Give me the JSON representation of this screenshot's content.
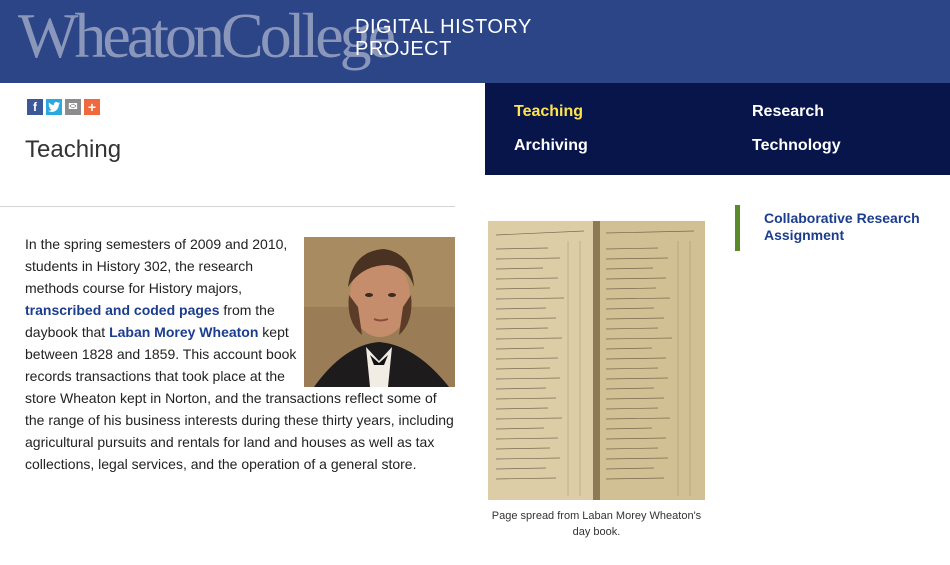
{
  "header": {
    "logo_text": "WheatonCollege",
    "site_title_line1": "DIGITAL HISTORY",
    "site_title_line2": "PROJECT"
  },
  "share": {
    "facebook": "f",
    "email": "✉",
    "more": "+"
  },
  "page": {
    "title": "Teaching"
  },
  "nav": {
    "items": [
      {
        "label": "Teaching",
        "active": true
      },
      {
        "label": "Research",
        "active": false
      },
      {
        "label": "Archiving",
        "active": false
      },
      {
        "label": "Technology",
        "active": false
      }
    ]
  },
  "content": {
    "p1": "In the spring semesters of 2009 and 2010, students in History 302, the research methods course for History majors, ",
    "link1": "transcribed and coded pages",
    "p2": " from the daybook that ",
    "link2": "Laban Morey Wheaton",
    "p3": " kept between 1828 and 1859.  This account book records transactions that took place at the store Wheaton kept in Norton, and the transactions reflect some of the range of his business interests during these thirty years, including agricultural pursuits and rentals for land and houses as well as tax collections, legal services, and the operation of a general store."
  },
  "figure": {
    "caption": "Page spread from Laban Morey Wheaton's day book."
  },
  "sidebar": {
    "link": "Collaborative Research Assignment"
  },
  "colors": {
    "header_bg": "#2c4587",
    "nav_bg": "#07154a",
    "nav_active": "#ffe34f",
    "link": "#1b3d8f",
    "sidebar_accent": "#5b8a2c"
  }
}
